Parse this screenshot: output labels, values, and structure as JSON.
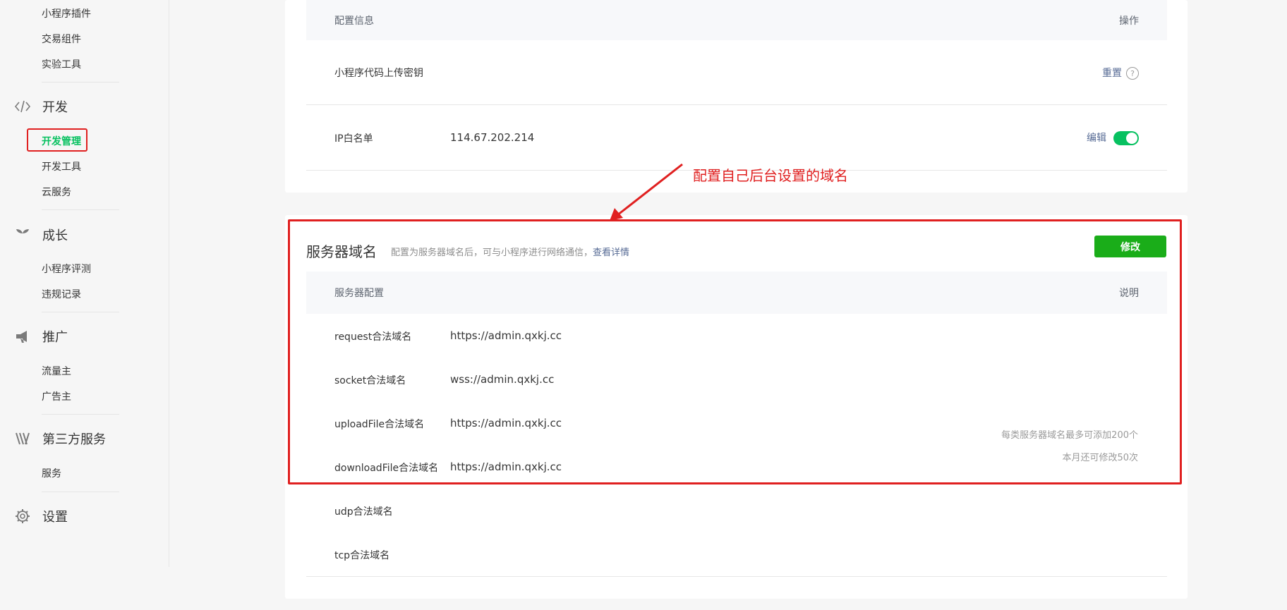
{
  "sidebar": {
    "items_top": [
      "小程序插件",
      "交易组件",
      "实验工具"
    ],
    "dev": {
      "title": "开发",
      "items": [
        "开发管理",
        "开发工具",
        "云服务"
      ]
    },
    "growth": {
      "title": "成长",
      "items": [
        "小程序评测",
        "违规记录"
      ]
    },
    "promo": {
      "title": "推广",
      "items": [
        "流量主",
        "广告主"
      ]
    },
    "third": {
      "title": "第三方服务",
      "items": [
        "服务"
      ]
    },
    "settings": {
      "title": "设置"
    }
  },
  "config": {
    "header_left": "配置信息",
    "header_right": "操作",
    "secret_label": "小程序代码上传密钥",
    "reset_label": "重置",
    "help_glyph": "?",
    "ip_label": "IP白名单",
    "ip_value": "114.67.202.214",
    "edit_label": "编辑",
    "ip_toggle_on": true
  },
  "server": {
    "title": "服务器域名",
    "desc_prefix": "配置为服务器域名后，可与小程序进行网络通信，",
    "desc_link": "查看详情",
    "modify_label": "修改",
    "header_left": "服务器配置",
    "header_right": "说明",
    "rows": [
      {
        "label": "request合法域名",
        "value": "https://admin.qxkj.cc"
      },
      {
        "label": "socket合法域名",
        "value": "wss://admin.qxkj.cc"
      },
      {
        "label": "uploadFile合法域名",
        "value": "https://admin.qxkj.cc"
      },
      {
        "label": "downloadFile合法域名",
        "value": "https://admin.qxkj.cc"
      },
      {
        "label": "udp合法域名",
        "value": ""
      },
      {
        "label": "tcp合法域名",
        "value": ""
      }
    ],
    "note1": "每类服务器域名最多可添加200个",
    "note2": "本月还可修改50次"
  },
  "annotation": {
    "text": "配置自己后台设置的域名"
  },
  "colors": {
    "accent_green": "#07c160",
    "button_green": "#1aad19",
    "annotation_red": "#e02020",
    "link_blue": "#576b95"
  },
  "icons": {
    "dev": "code-icon",
    "growth": "sprout-icon",
    "promo": "megaphone-icon",
    "third": "third-party-icon",
    "settings": "gear-icon"
  }
}
